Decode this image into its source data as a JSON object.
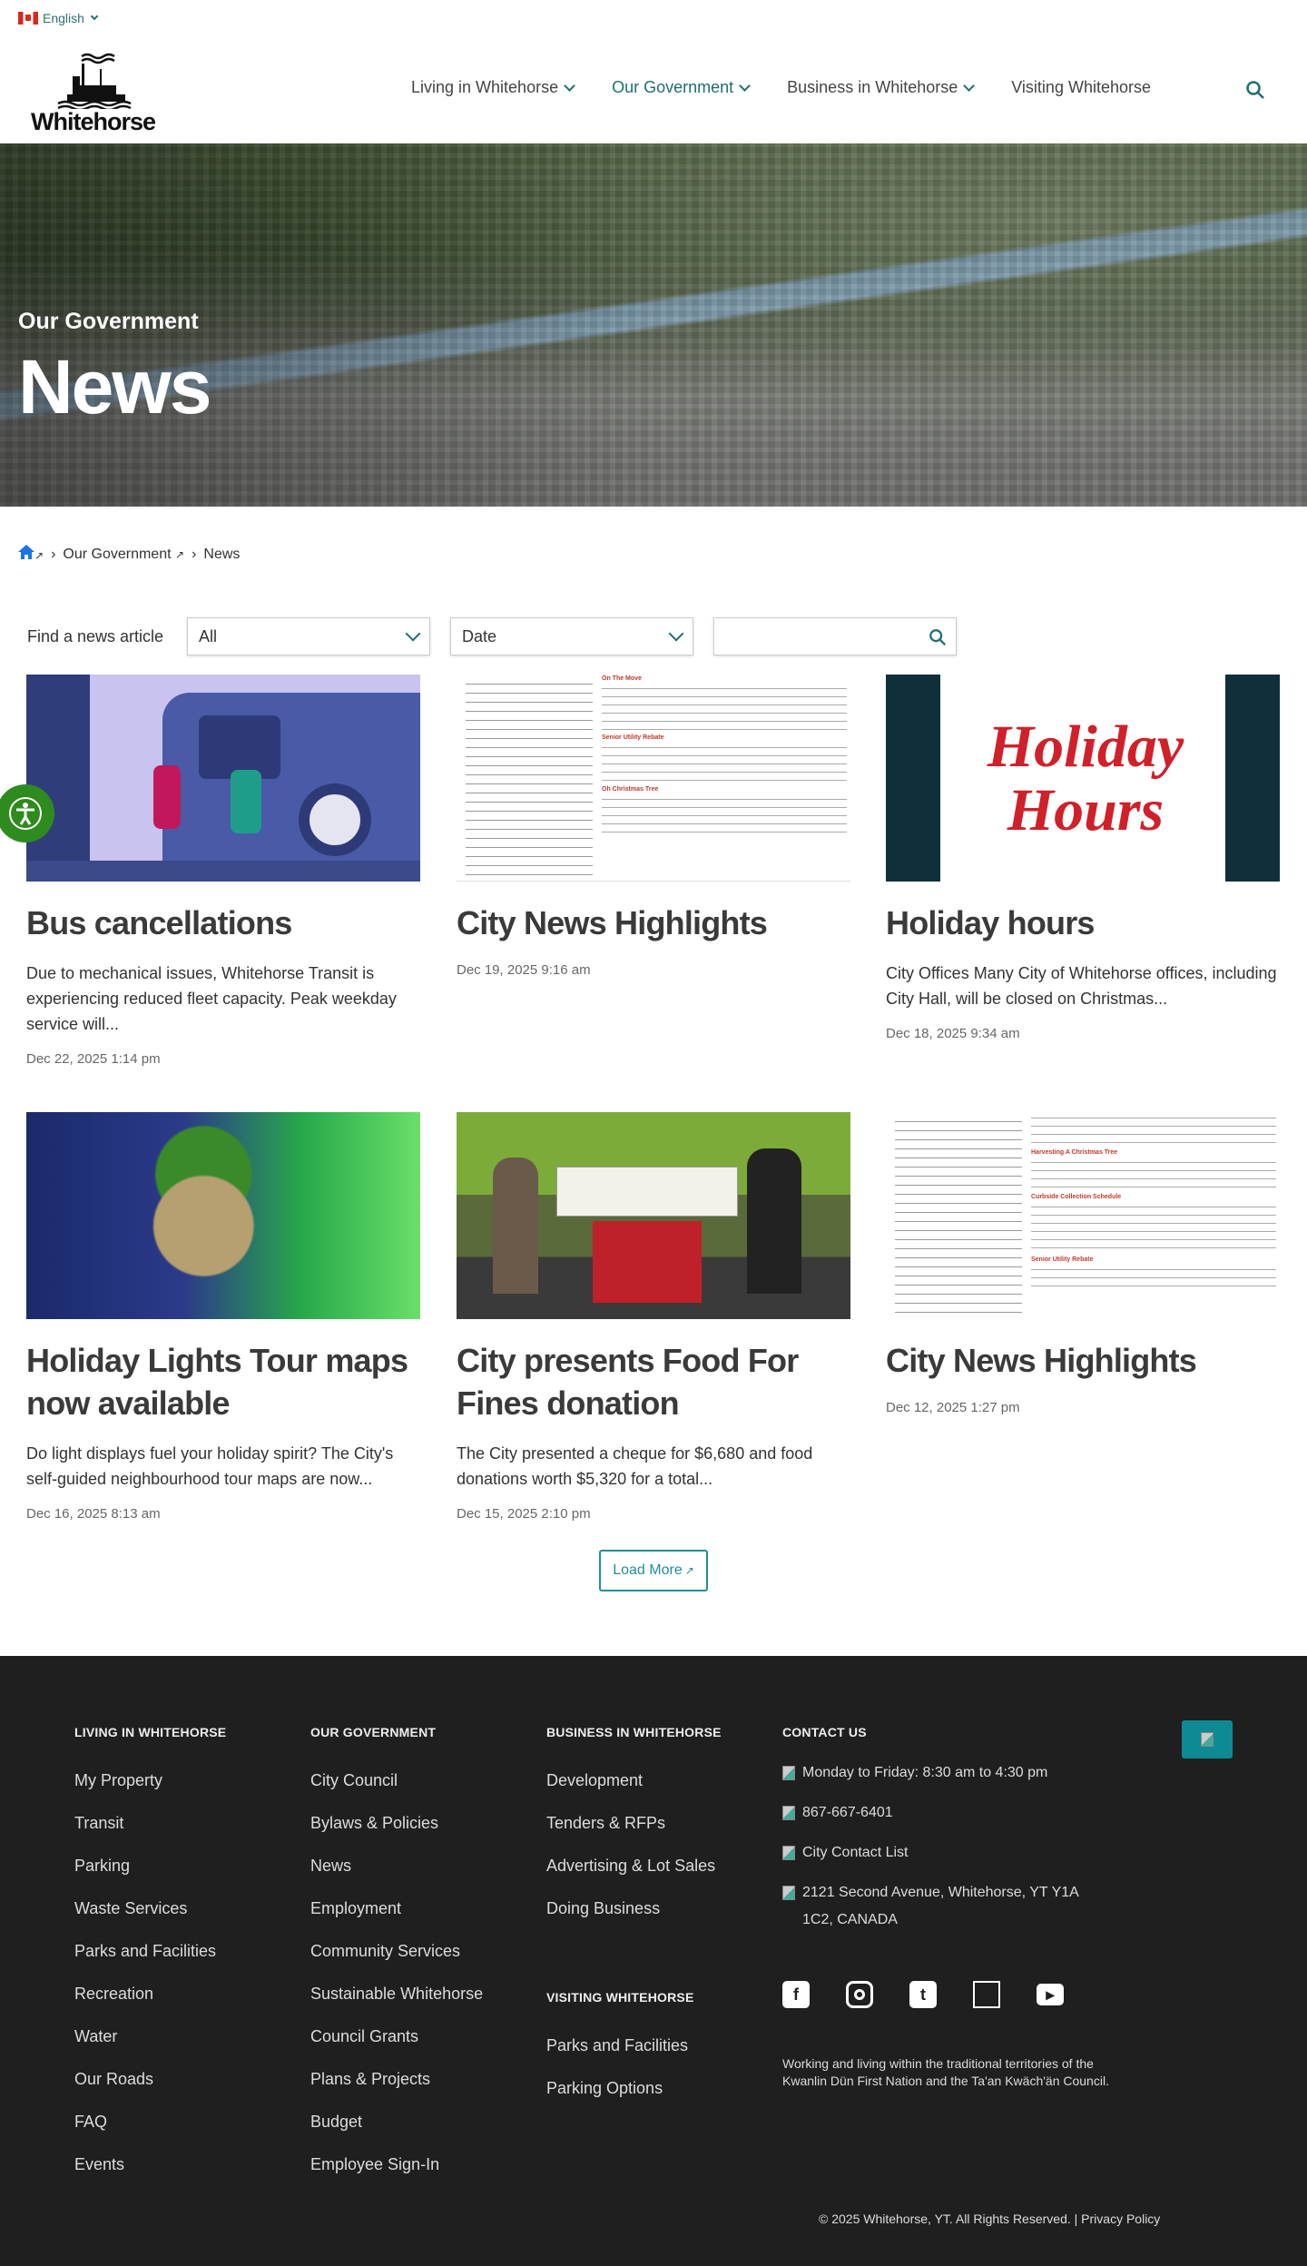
{
  "header": {
    "language": "English",
    "logo_text": "Whitehorse",
    "nav": [
      {
        "label": "Living in Whitehorse",
        "dropdown": true
      },
      {
        "label": "Our Government",
        "dropdown": true,
        "active": true
      },
      {
        "label": "Business in Whitehorse",
        "dropdown": true
      },
      {
        "label": "Visiting Whitehorse",
        "dropdown": false
      }
    ]
  },
  "hero": {
    "subtitle": "Our Government",
    "title": "News"
  },
  "breadcrumb": {
    "items": [
      "Our Government",
      "News"
    ]
  },
  "filters": {
    "label": "Find a news article",
    "category": "All",
    "sort": "Date",
    "search_value": ""
  },
  "articles": [
    {
      "title": "Bus cancellations",
      "excerpt": "Due to mechanical issues, Whitehorse Transit is experiencing reduced fleet capacity. Peak weekday service will...",
      "date": "Dec 22, 2025 1:14 pm"
    },
    {
      "title": "City News Highlights",
      "excerpt": "",
      "date": "Dec 19, 2025 9:16 am"
    },
    {
      "title": "Holiday hours",
      "excerpt": "City Offices Many City of Whitehorse offices, including City Hall, will be closed on Christmas...",
      "date": "Dec 18, 2025 9:34 am"
    },
    {
      "title": "Holiday Lights Tour maps now available",
      "excerpt": "Do light displays fuel your holiday spirit? The City's self-guided neighbourhood tour maps are now...",
      "date": "Dec 16, 2025 8:13 am"
    },
    {
      "title": "City presents Food For Fines donation",
      "excerpt": "The City presented a cheque for $6,680 and food donations worth $5,320 for a total...",
      "date": "Dec 15, 2025 2:10 pm"
    },
    {
      "title": "City News Highlights",
      "excerpt": "",
      "date": "Dec 12, 2025 1:27 pm"
    }
  ],
  "images": {
    "holiday_hours_text": "Holiday Hours",
    "news1_headings": [
      "On The Move",
      "Senior Utility Rebate",
      "Oh Christmas Tree"
    ],
    "news2_headings": [
      "Harvesting A Christmas Tree",
      "Curbside Collection Schedule",
      "Senior Utility Rebate"
    ]
  },
  "load_more": "Load More",
  "footer": {
    "columns": [
      {
        "heading": "LIVING IN WHITEHORSE",
        "links": [
          "My Property",
          "Transit",
          "Parking",
          "Waste Services",
          "Parks and Facilities",
          "Recreation",
          "Water",
          "Our Roads",
          "FAQ",
          "Events"
        ]
      },
      {
        "heading": "OUR GOVERNMENT",
        "links": [
          "City Council",
          "Bylaws & Policies",
          "News",
          "Employment",
          "Community Services",
          "Sustainable Whitehorse",
          "Council Grants",
          "Plans & Projects",
          "Budget",
          "Employee Sign-In"
        ]
      },
      {
        "heading": "BUSINESS IN WHITEHORSE",
        "links": [
          "Development",
          "Tenders & RFPs",
          "Advertising & Lot Sales",
          "Doing Business"
        ]
      },
      {
        "heading": "VISITING WHITEHORSE",
        "links": [
          "Parks and Facilities",
          "Parking Options"
        ]
      }
    ],
    "contact": {
      "heading": "CONTACT US",
      "hours": "Monday to Friday: 8:30 am to 4:30 pm",
      "phone": "867-667-6401",
      "contact_list": "City Contact List",
      "address": "2121 Second Avenue, Whitehorse, YT Y1A 1C2, CANADA"
    },
    "acknowledgement": "Working and living within the traditional territories of the Kwanlin Dün First Nation and the Ta'an Kwäch'än Council.",
    "copyright": "© 2025 Whitehorse, YT. All Rights Reserved.",
    "privacy": "Privacy Policy"
  },
  "colors": {
    "accent": "#1e6e72",
    "teal": "#0e8a94",
    "footer_bg": "#1f1f1f",
    "a11y": "#2e8b1d"
  }
}
